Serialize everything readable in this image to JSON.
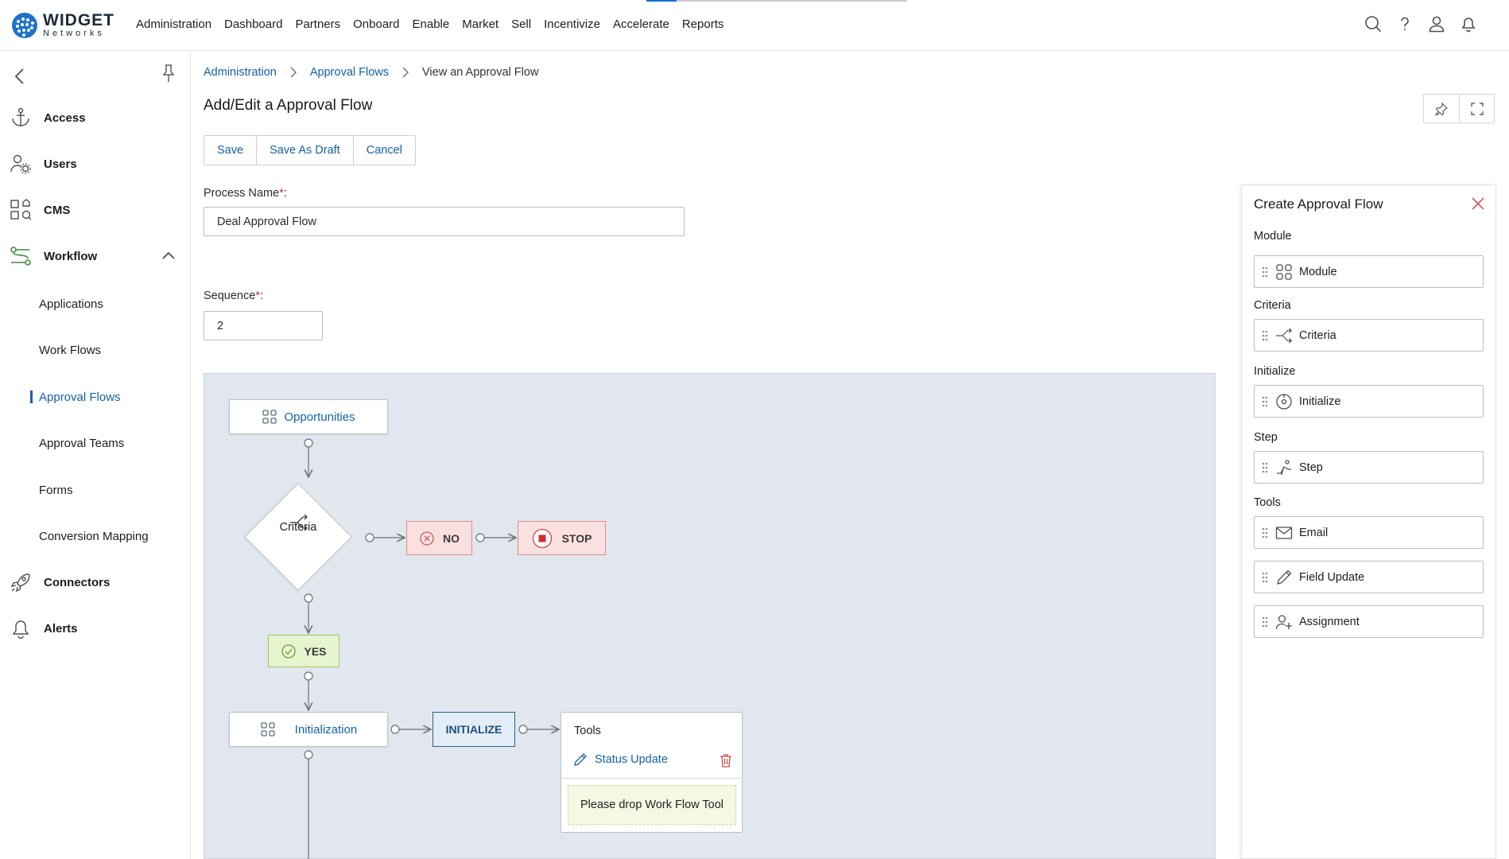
{
  "brand": {
    "name": "WIDGET",
    "sub": "Networks"
  },
  "nav": [
    "Administration",
    "Dashboard",
    "Partners",
    "Onboard",
    "Enable",
    "Market",
    "Sell",
    "Incentivize",
    "Accelerate",
    "Reports"
  ],
  "sidebar": {
    "items": [
      {
        "label": "Access",
        "icon": "anchor-icon"
      },
      {
        "label": "Users",
        "icon": "users-gear-icon"
      },
      {
        "label": "CMS",
        "icon": "cms-icon"
      },
      {
        "label": "Workflow",
        "icon": "workflow-icon"
      },
      {
        "label": "Connectors",
        "icon": "rocket-icon"
      },
      {
        "label": "Alerts",
        "icon": "bell-icon"
      }
    ],
    "subitems": [
      "Applications",
      "Work Flows",
      "Approval Flows",
      "Approval Teams",
      "Forms",
      "Conversion Mapping"
    ],
    "active_subitem": "Approval Flows"
  },
  "breadcrumb": {
    "item1": "Administration",
    "item2": "Approval Flows",
    "current": "View an Approval Flow"
  },
  "page": {
    "title": "Add/Edit a Approval Flow"
  },
  "actions": {
    "save": "Save",
    "save_draft": "Save As Draft",
    "cancel": "Cancel"
  },
  "form": {
    "process_name_label": "Process Name",
    "process_name_value": "Deal Approval Flow",
    "sequence_label": "Sequence",
    "sequence_value": "2",
    "required_mark": "*",
    "colon": ":"
  },
  "flow": {
    "module_node": "Opportunities",
    "criteria_node": "Criteria",
    "no_node": "NO",
    "stop_node": "STOP",
    "yes_node": "YES",
    "init_node": "Initialization",
    "initialize_node": "INITIALIZE",
    "tools_title": "Tools",
    "tool_item": "Status Update",
    "drop_hint": "Please drop Work Flow Tool"
  },
  "panel": {
    "title": "Create Approval Flow",
    "sections": [
      {
        "heading": "Module",
        "items": [
          {
            "label": "Module",
            "icon": "grid-icon"
          }
        ]
      },
      {
        "heading": "Criteria",
        "items": [
          {
            "label": "Criteria",
            "icon": "branch-icon"
          }
        ]
      },
      {
        "heading": "Initialize",
        "items": [
          {
            "label": "Initialize",
            "icon": "dial-icon"
          }
        ]
      },
      {
        "heading": "Step",
        "items": [
          {
            "label": "Step",
            "icon": "step-icon"
          }
        ]
      },
      {
        "heading": "Tools",
        "items": [
          {
            "label": "Email",
            "icon": "mail-icon"
          },
          {
            "label": "Field Update",
            "icon": "pencil-icon"
          },
          {
            "label": "Assignment",
            "icon": "user-add-icon"
          }
        ]
      }
    ]
  },
  "colors": {
    "accent": "#1460a8",
    "canvas_bg": "#e2e7ef",
    "no_bg": "#fbe0e0",
    "yes_bg": "#e7f5cf"
  }
}
